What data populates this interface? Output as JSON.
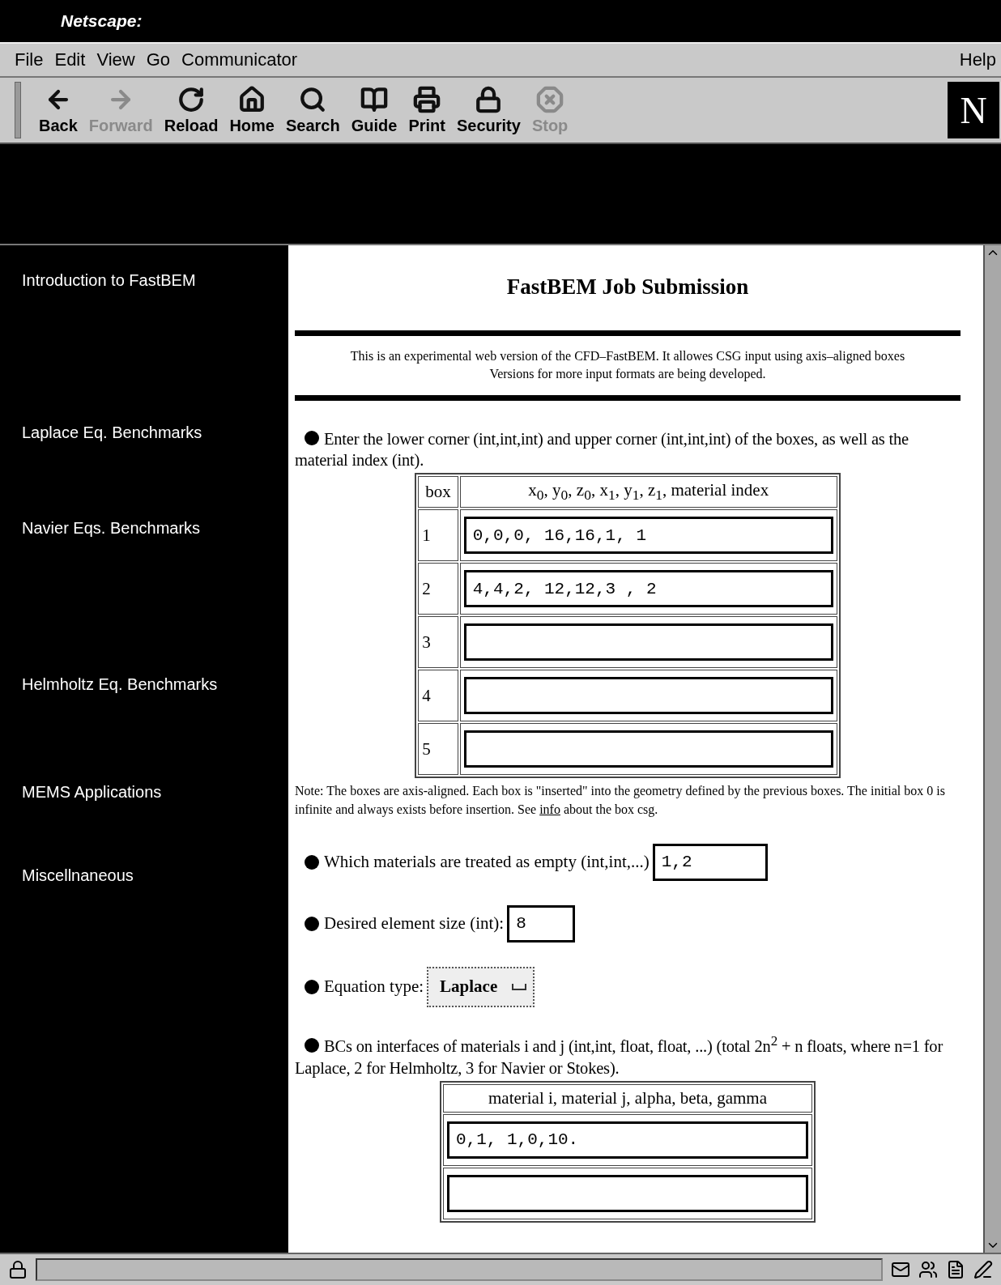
{
  "window": {
    "title": "Netscape:"
  },
  "menu": [
    {
      "label": "File"
    },
    {
      "label": "Edit"
    },
    {
      "label": "View"
    },
    {
      "label": "Go"
    },
    {
      "label": "Communicator"
    }
  ],
  "help_menu": {
    "label": "Help"
  },
  "toolbar": [
    {
      "label": "Back",
      "disabled": false
    },
    {
      "label": "Forward",
      "disabled": true
    },
    {
      "label": "Reload",
      "disabled": false
    },
    {
      "label": "Home",
      "disabled": false
    },
    {
      "label": "Search",
      "disabled": false
    },
    {
      "label": "Guide",
      "disabled": false
    },
    {
      "label": "Print",
      "disabled": false
    },
    {
      "label": "Security",
      "disabled": false
    },
    {
      "label": "Stop",
      "disabled": true
    }
  ],
  "logo": "N",
  "sidebar": [
    {
      "heading": "Introduction to FastBEM"
    },
    {
      "heading": "Laplace Eq. Benchmarks"
    },
    {
      "heading": "Navier Eqs. Benchmarks"
    },
    {
      "heading": "Helmholtz Eq. Benchmarks"
    },
    {
      "heading": "MEMS Applications"
    },
    {
      "heading": "Miscellnaneous"
    }
  ],
  "page": {
    "title": "FastBEM Job Submission",
    "intro": "This is an experimental web version of the CFD–FastBEM. It allowes CSG input using axis–aligned boxes Versions for more input formats are being developed.",
    "boxes": {
      "instruction": "Enter the lower corner (int,int,int) and upper corner (int,int,int) of the boxes, as well as the material index (int).",
      "columns": [
        "box",
        "x$_{0}$, y$_{0}$, z$_{0}$,  x$_{1}$, y$_{1}$, z$_{1}$,  material index"
      ],
      "rows": [
        {
          "index": "1",
          "value": "0,0,0, 16,16,1, 1"
        },
        {
          "index": "2",
          "value": "4,4,2, 12,12,3 , 2"
        },
        {
          "index": "3"
        },
        {
          "index": "4"
        },
        {
          "index": "5"
        }
      ]
    },
    "note": {
      "before": "Note: The boxes are axis-aligned. Each box is \"inserted\" into the geometry defined by the previous boxes. The initial box 0 is infinite and always exists before insertion. See ",
      "link": "info",
      "after": " about the box csg."
    },
    "empty_materials": {
      "label": "Which materials are treated as empty (int,int,...)",
      "value": "1,2"
    },
    "element_size": {
      "label": "Desired element size (int):",
      "value": "8"
    },
    "equation": {
      "label": "Equation type:",
      "value": "Laplace"
    },
    "bcs": {
      "instruction": "BCs on interfaces of materials i and j (int,int, float, float, ...) (total 2n$^{2}$ + n floats, where n=1 for Laplace, 2 for Helmholtz, 3 for Navier or Stokes).",
      "columns": [
        "material i, material j, alpha, beta, gamma"
      ],
      "rows": [
        {
          "value": "0,1, 1,0,10."
        },
        {}
      ]
    }
  }
}
